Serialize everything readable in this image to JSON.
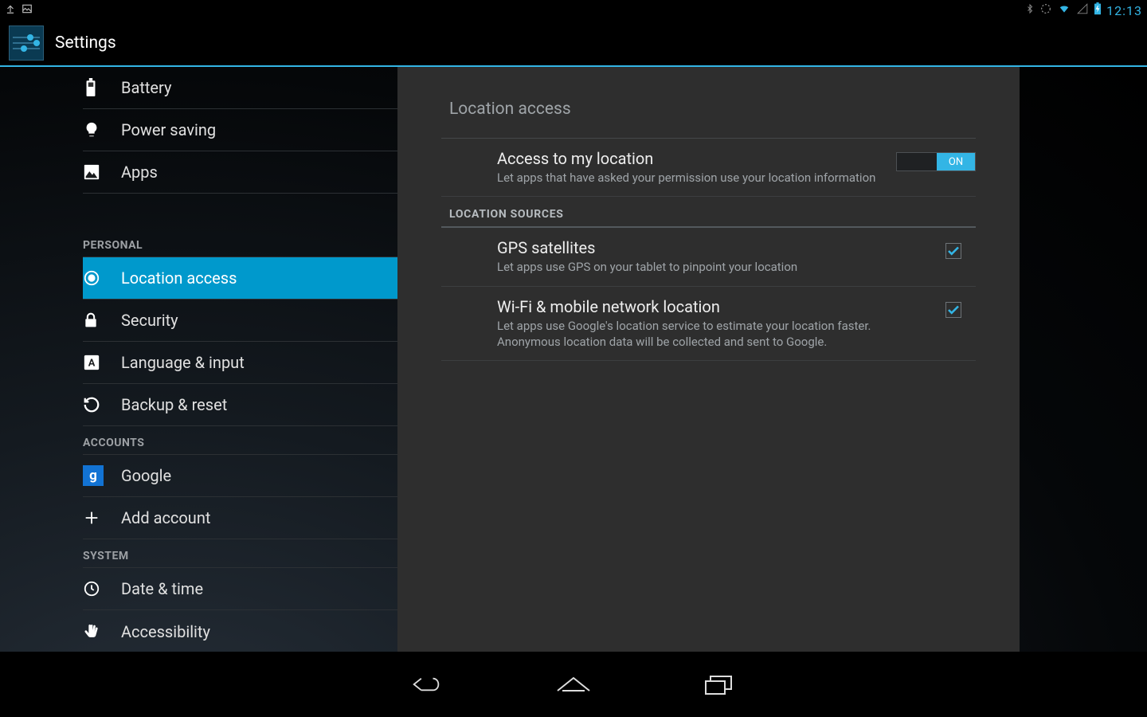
{
  "status": {
    "time": "12:13"
  },
  "action_bar": {
    "title": "Settings"
  },
  "sidebar": {
    "items": [
      {
        "id": "battery",
        "label": "Battery",
        "icon": "battery-icon"
      },
      {
        "id": "power",
        "label": "Power saving",
        "icon": "bulb-icon"
      },
      {
        "id": "apps",
        "label": "Apps",
        "icon": "apps-icon"
      }
    ],
    "personal_header": "PERSONAL",
    "personal": [
      {
        "id": "location",
        "label": "Location access",
        "icon": "location-icon",
        "selected": true
      },
      {
        "id": "security",
        "label": "Security",
        "icon": "lock-icon"
      },
      {
        "id": "language",
        "label": "Language & input",
        "icon": "language-icon"
      },
      {
        "id": "backup",
        "label": "Backup & reset",
        "icon": "restore-icon"
      }
    ],
    "accounts_header": "ACCOUNTS",
    "accounts": [
      {
        "id": "google",
        "label": "Google",
        "icon": "google-icon"
      },
      {
        "id": "add",
        "label": "Add account",
        "icon": "plus-icon"
      }
    ],
    "system_header": "SYSTEM",
    "system": [
      {
        "id": "datetime",
        "label": "Date & time",
        "icon": "clock-icon"
      },
      {
        "id": "access",
        "label": "Accessibility",
        "icon": "hand-icon"
      }
    ]
  },
  "detail": {
    "title": "Location access",
    "toggle_label": "ON",
    "access": {
      "title": "Access to my location",
      "sub": "Let apps that have asked your permission use your location information"
    },
    "sources_header": "LOCATION SOURCES",
    "gps": {
      "title": "GPS satellites",
      "sub": "Let apps use GPS on your tablet to pinpoint your location",
      "checked": true
    },
    "wifi": {
      "title": "Wi-Fi & mobile network location",
      "sub": "Let apps use Google's location service to estimate your location faster. Anonymous location data will be collected and sent to Google.",
      "checked": true
    }
  }
}
